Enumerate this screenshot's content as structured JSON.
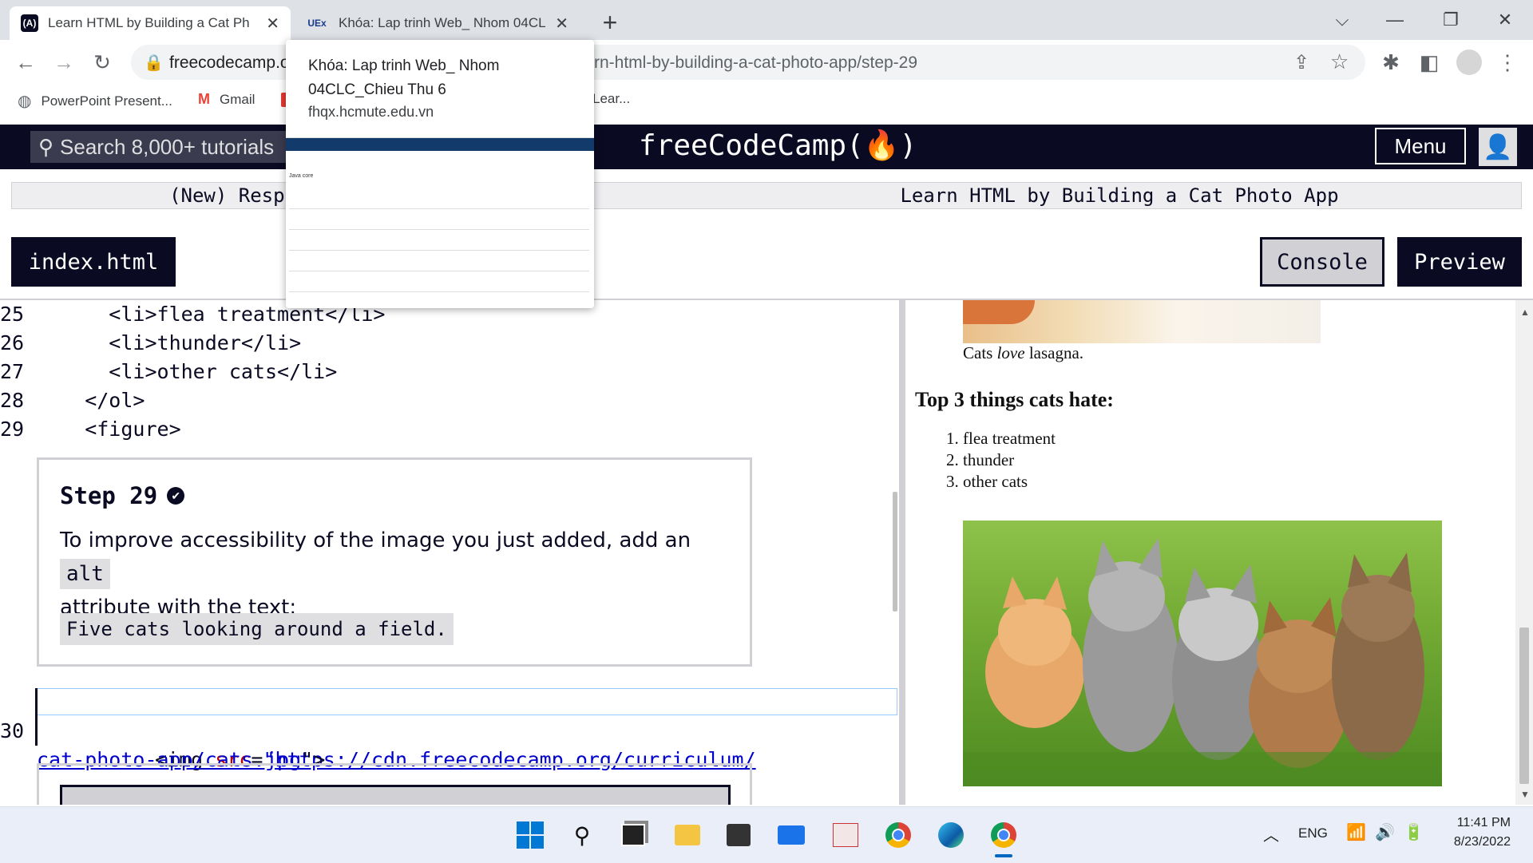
{
  "browser": {
    "tabs": [
      {
        "title": "Learn HTML by Building a Cat Ph",
        "favicon": "(A)",
        "close": "✕"
      },
      {
        "title": "Khóa: Lap trinh Web_ Nhom 04CL",
        "favicon": "UEx",
        "close": "✕"
      }
    ],
    "new_tab": "+",
    "url_host": "freecodecamp.o",
    "url_tail": "rn-html-by-building-a-cat-photo-app/step-29",
    "bookmarks": [
      {
        "label": "PowerPoint Present...",
        "icon": "globe-icon"
      },
      {
        "label": "Gmail",
        "icon": "gmail-icon"
      },
      {
        "label": "Lear...",
        "icon": ""
      }
    ]
  },
  "tab_popup": {
    "title": "Khóa: Lap trinh Web_ Nhom 04CLC_Chieu Thu 6",
    "host": "fhqx.hcmute.edu.vn",
    "thumb_heading": "Java core"
  },
  "fcc": {
    "search_placeholder": "Search 8,000+ tutorials",
    "logo": "freeCodeCamp(🔥)",
    "menu": "Menu",
    "breadcrumb_left": "(New) Respons",
    "breadcrumb_right": "Learn HTML by Building a Cat Photo App",
    "file_tab": "index.html",
    "console": "Console",
    "preview": "Preview"
  },
  "editor": {
    "lines": [
      {
        "n": "25",
        "code": "      <li>flea treatment</li>"
      },
      {
        "n": "26",
        "code": "      <li>thunder</li>"
      },
      {
        "n": "27",
        "code": "      <li>other cats</li>"
      },
      {
        "n": "28",
        "code": "    </ol>"
      },
      {
        "n": "29",
        "code": "    <figure>"
      }
    ],
    "step": {
      "title": "Step 29",
      "text_before": "To improve accessibility of the image you just added, add an",
      "attr": "alt",
      "text_after": "attribute with the text:",
      "alt_text": "Five cats looking around a field."
    },
    "line30": {
      "n": "30",
      "tag_open": "<img ",
      "attr_name": "src",
      "eq": "=",
      "quote": "\"",
      "url_part1": "https://cdn.freecodecamp.org/curriculum/",
      "url_part2": "cat-photo-app/cats.jpg",
      "close": "\">"
    }
  },
  "preview": {
    "caption_prefix": "Cats ",
    "caption_em": "love",
    "caption_suffix": " lasagna.",
    "heading": "Top 3 things cats hate:",
    "list": [
      "flea treatment",
      "thunder",
      "other cats"
    ]
  },
  "taskbar": {
    "lang": "ENG",
    "time": "11:41 PM",
    "date": "8/23/2022"
  }
}
